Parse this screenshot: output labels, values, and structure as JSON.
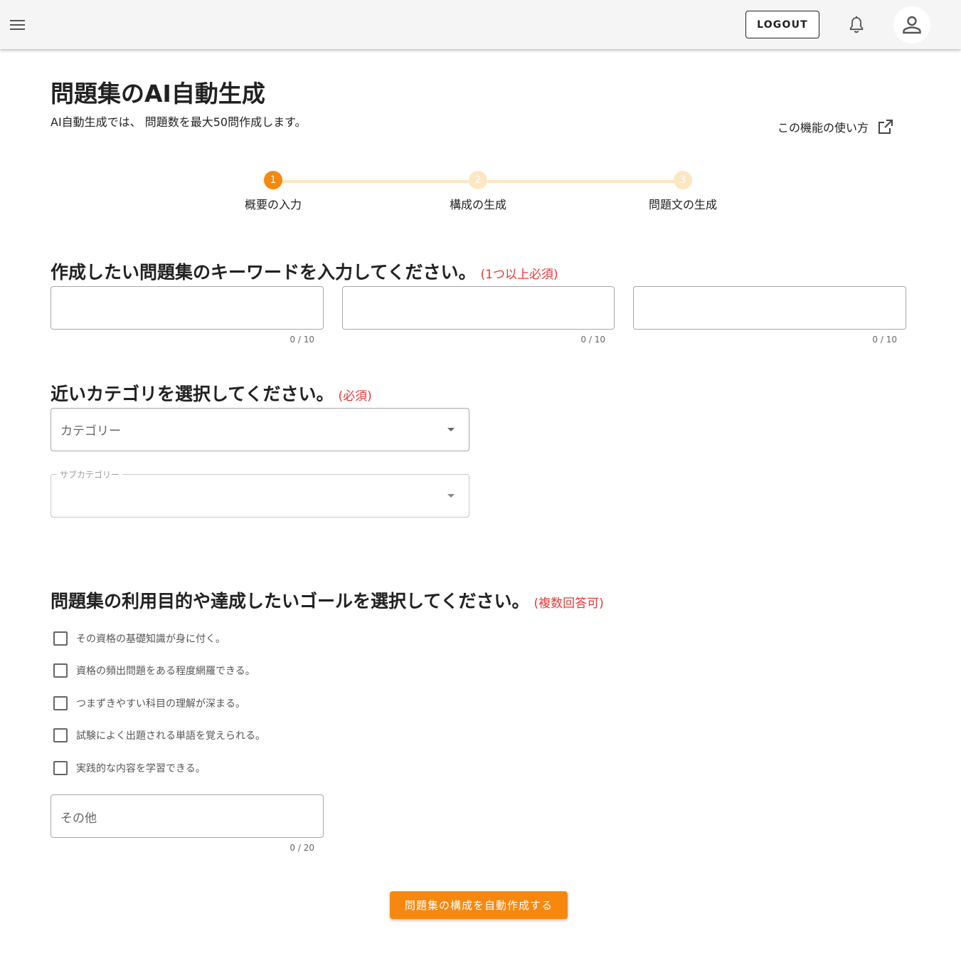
{
  "header": {
    "logout_label": "LOGOUT"
  },
  "main": {
    "title": "問題集のAI自動生成",
    "subtitle": "AI自動生成では、 問題数を最大50問作成します。",
    "help_link": "この機能の使い方"
  },
  "stepper": {
    "steps": [
      {
        "number": "1",
        "label": "概要の入力",
        "state": "active"
      },
      {
        "number": "2",
        "label": "構成の生成",
        "state": "inactive"
      },
      {
        "number": "3",
        "label": "問題文の生成",
        "state": "inactive"
      }
    ]
  },
  "keywords": {
    "heading": "作成したい問題集のキーワードを入力してください。",
    "note": "(1つ以上必須)",
    "fields": [
      {
        "value": "",
        "counter": "0 / 10"
      },
      {
        "value": "",
        "counter": "0 / 10"
      },
      {
        "value": "",
        "counter": "0 / 10"
      }
    ]
  },
  "category": {
    "heading": "近いカテゴリを選択してください。",
    "note": "(必須)",
    "category_placeholder": "カテゴリー",
    "subcategory_label": "サブカテゴリー"
  },
  "goals": {
    "heading": "問題集の利用目的や達成したいゴールを選択してください。",
    "note": "(複数回答可)",
    "options": [
      {
        "label": "その資格の基礎知識が身に付く。",
        "checked": false
      },
      {
        "label": "資格の頻出問題をある程度網羅できる。",
        "checked": false
      },
      {
        "label": "つまずきやすい科目の理解が深まる。",
        "checked": false
      },
      {
        "label": "試験によく出題される単語を覚えられる。",
        "checked": false
      },
      {
        "label": "実践的な内容を学習できる。",
        "checked": false
      }
    ],
    "other_placeholder": "その他",
    "other_counter": "0 / 20"
  },
  "submit_label": "問題集の構成を自動作成する",
  "colors": {
    "accent": "#f7880f",
    "accent_light": "#fde7c3",
    "required": "#e53935"
  }
}
